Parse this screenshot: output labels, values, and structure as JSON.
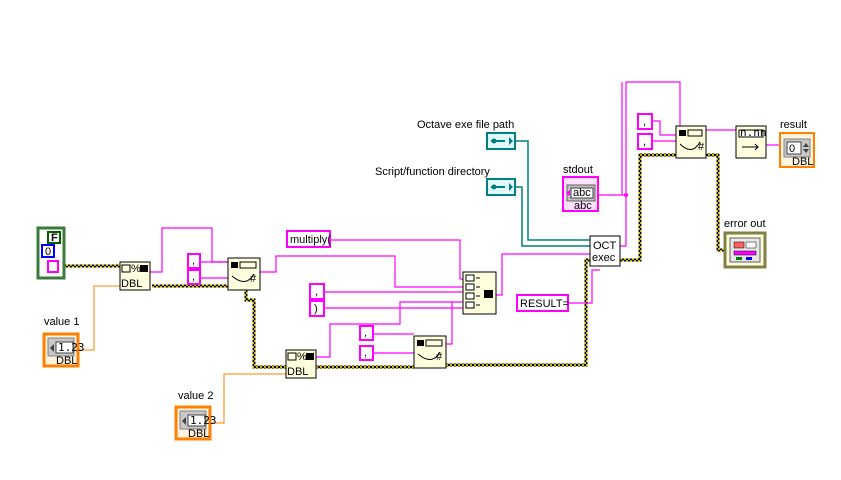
{
  "diagram": {
    "labels": {
      "octave_path": "Octave exe file path",
      "script_dir": "Script/function directory",
      "stdout": "stdout",
      "value1": "value 1",
      "value2": "value 2",
      "result": "result",
      "error_out": "error out"
    },
    "constants": {
      "multiply": "multiply(",
      "comma": ",",
      "close_paren": ")",
      "result_eq": "RESULT=",
      "comma_top": ",",
      "comma_mid": ",",
      "comma_low": ",",
      "comma_a": ",",
      "comma_b": ","
    },
    "controls": {
      "value1_text": "1.23",
      "value2_text": "1.23",
      "value1_type": "DBL",
      "value2_type": "DBL",
      "stdout_text": "abc",
      "stdout_type": "abc",
      "result_value": "0",
      "result_type": "DBL",
      "cluster_bool": "F",
      "cluster_num": "0"
    },
    "node_text": {
      "format1": "%",
      "format1_type": "DBL",
      "format2": "%",
      "format2_type": "DBL",
      "oct_line1": "OCT",
      "oct_line2": "exec",
      "scan_icon": "n.nn"
    },
    "colors": {
      "string_wire": "#ff00ff",
      "path_wire": "#008080",
      "double_wire": "#ff8000",
      "error_wire": "#c8a000"
    }
  }
}
